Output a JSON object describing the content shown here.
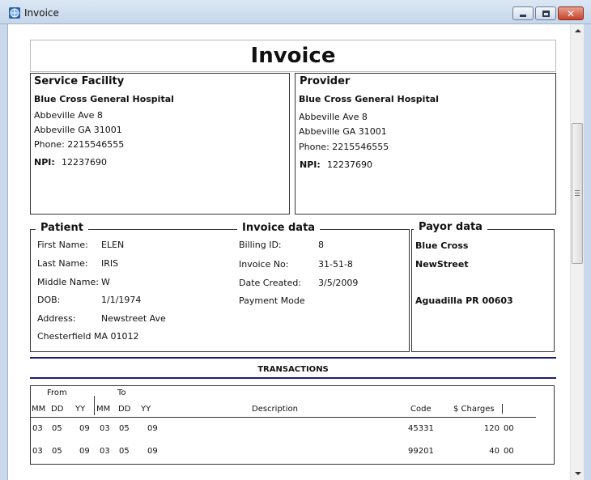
{
  "window": {
    "title": "Invoice"
  },
  "document": {
    "heading": "Invoice",
    "service_facility": {
      "section": "Service Facility",
      "name": "Blue Cross General Hospital",
      "address1": "Abbeville Ave 8",
      "address2": "Abbeville GA 31001",
      "phone": "Phone: 2215546555",
      "npi_label": "NPI:",
      "npi_value": "12237690"
    },
    "provider": {
      "section": "Provider",
      "name": "Blue Cross General Hospital",
      "address1": "Abbeville Ave 8",
      "address2": "Abbeville GA 31001",
      "phone": "Phone: 2215546555",
      "npi_label": "NPI:",
      "npi_value": "12237690"
    },
    "patient": {
      "legend": "Patient",
      "first_name_label": "First Name:",
      "first_name": "ELEN",
      "last_name_label": "Last Name:",
      "last_name": "IRIS",
      "middle_name_label": "Middle Name:",
      "middle_name": "W",
      "dob_label": "DOB:",
      "dob": "1/1/1974",
      "address_label": "Address:",
      "address": "Newstreet Ave",
      "city_line": "Chesterfield MA 01012"
    },
    "invoice_data": {
      "legend": "Invoice data",
      "billing_id_label": "Billing ID:",
      "billing_id": "8",
      "invoice_no_label": "Invoice No:",
      "invoice_no": "31-51-8",
      "date_created_label": "Date Created:",
      "date_created": "3/5/2009",
      "payment_mode_label": "Payment Mode"
    },
    "payor": {
      "legend": "Payor data",
      "name": "Blue Cross",
      "street": "NewStreet",
      "city_line": "Aguadilla PR 00603"
    },
    "transactions": {
      "title": "TRANSACTIONS",
      "group_from": "From",
      "group_to": "To",
      "headers": {
        "mm": "MM",
        "dd": "DD",
        "yy": "YY",
        "mm2": "MM",
        "dd2": "DD",
        "yy2": "YY",
        "description": "Description",
        "code": "Code",
        "charges": "$ Charges"
      },
      "rows": [
        {
          "mm": "03",
          "dd": "05",
          "yy": "09",
          "mm2": "03",
          "dd2": "05",
          "yy2": "09",
          "description": "",
          "code": "45331",
          "charges": "120",
          "cents": "00"
        },
        {
          "mm": "03",
          "dd": "05",
          "yy": "09",
          "mm2": "03",
          "dd2": "05",
          "yy2": "09",
          "description": "",
          "code": "99201",
          "charges": "40",
          "cents": "00"
        }
      ]
    }
  }
}
